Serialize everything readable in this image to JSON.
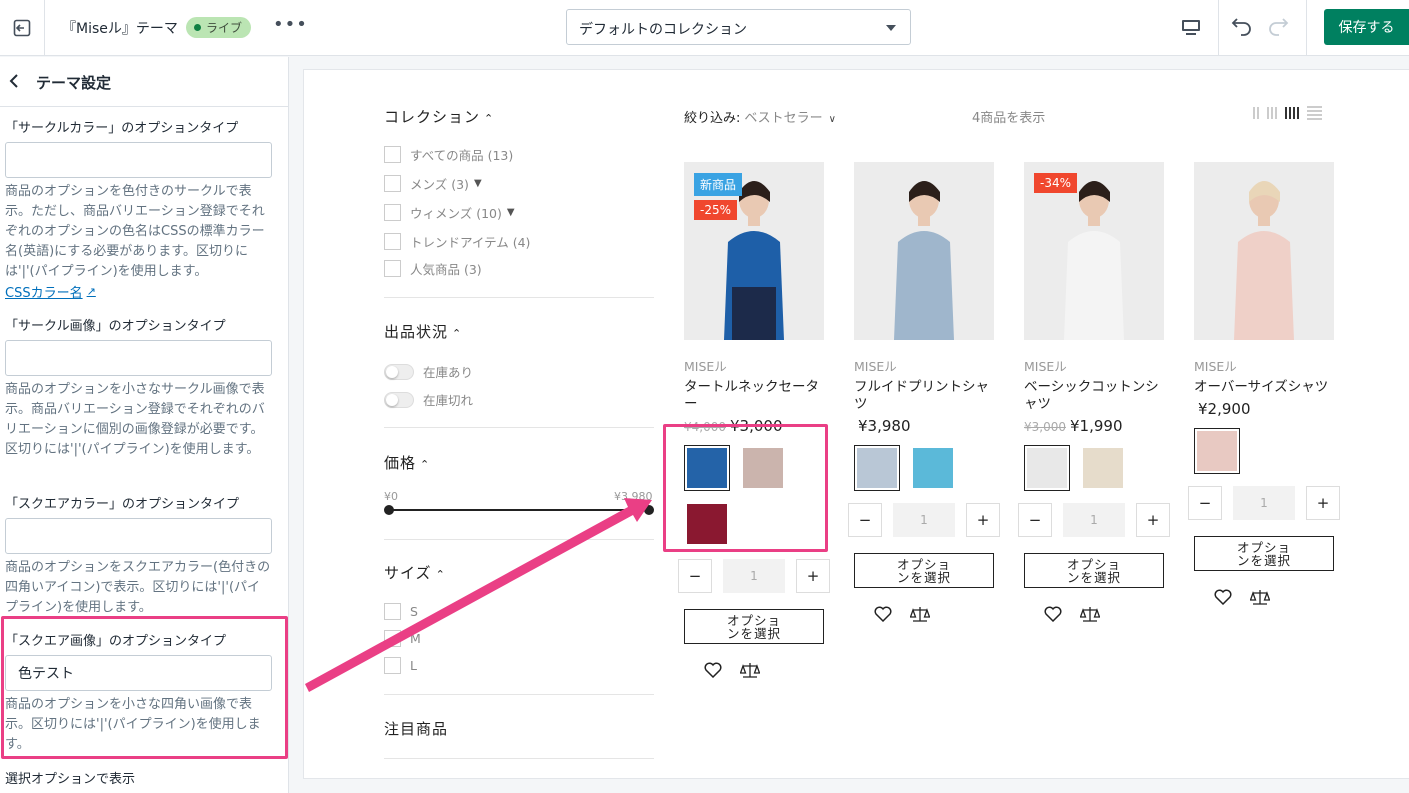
{
  "topbar": {
    "theme_name": "『Miseル』テーマ",
    "live_badge": "ライブ",
    "more": "•••",
    "collection_select": "デフォルトのコレクション",
    "save_label": "保存する"
  },
  "sidebar": {
    "title": "テーマ設定",
    "sections": [
      {
        "label": "「サークルカラー」のオプションタイプ",
        "value": "",
        "help": "商品のオプションを色付きのサークルで表示。ただし、商品バリエーション登録でそれぞれのオプションの色名はCSSの標準カラー名(英語)にする必要があります。区切りには'|'(パイプライン)を使用します。",
        "link": "CSSカラー名"
      },
      {
        "label": "「サークル画像」のオプションタイプ",
        "value": "",
        "help": "商品のオプションを小さなサークル画像で表示。商品バリエーション登録でそれぞれのバリエーションに個別の画像登録が必要です。区切りには'|'(パイプライン)を使用します。"
      },
      {
        "label": "「スクエアカラー」のオプションタイプ",
        "value": "",
        "help": "商品のオプションをスクエアカラー(色付きの四角いアイコン)で表示。区切りには'|'(パイプライン)を使用します。"
      },
      {
        "label": "「スクエア画像」のオプションタイプ",
        "value": "色テスト",
        "help": "商品のオプションを小さな四角い画像で表示。区切りには'|'(パイプライン)を使用します。"
      }
    ],
    "bottom_label": "選択オプションで表示"
  },
  "filters": {
    "collection_title": "コレクション",
    "collections": [
      {
        "label": "すべての商品 (13)",
        "sub": false
      },
      {
        "label": "メンズ (3)",
        "sub": true
      },
      {
        "label": "ウィメンズ (10)",
        "sub": true
      },
      {
        "label": "トレンドアイテム (4)",
        "sub": false
      },
      {
        "label": "人気商品 (3)",
        "sub": false
      }
    ],
    "stock_title": "出品状況",
    "stock": [
      "在庫あり",
      "在庫切れ"
    ],
    "price_title": "価格",
    "price_min": "¥0",
    "price_max": "¥3,980",
    "size_title": "サイズ",
    "sizes": [
      "S",
      "M",
      "L"
    ],
    "featured_title": "注目商品"
  },
  "toolbar": {
    "sort_prefix": "絞り込み:",
    "sort_value": "ベストセラー",
    "count": "4商品を表示"
  },
  "products": [
    {
      "badges": [
        {
          "text": "新商品",
          "type": "new"
        },
        {
          "text": "-25%",
          "type": "sale"
        }
      ],
      "vendor": "MISEル",
      "title": "タートルネックセーター",
      "old_price": "¥4,000",
      "price": "¥3,000",
      "image_color": "#1e5fa8",
      "swatches": [
        "#2463a8",
        "#cbb4ad",
        "#8a1830"
      ],
      "qty": "1",
      "option_label": "オプションを選択"
    },
    {
      "badges": [],
      "vendor": "MISEル",
      "title": "フルイドプリントシャツ",
      "old_price": "",
      "price": "¥3,980",
      "image_color": "#9fb6cc",
      "swatches": [
        "#b9c7d6",
        "#5bb9d9"
      ],
      "qty": "1",
      "option_label": "オプションを選択"
    },
    {
      "badges": [
        {
          "text": "-34%",
          "type": "sale"
        }
      ],
      "vendor": "MISEル",
      "title": "ベーシックコットンシャツ",
      "old_price": "¥3,000",
      "price": "¥1,990",
      "image_color": "#f4f4f4",
      "swatches": [
        "#e8e8e8",
        "#e6dccb"
      ],
      "qty": "1",
      "option_label": "オプションを選択"
    },
    {
      "badges": [],
      "vendor": "MISEル",
      "title": "オーバーサイズシャツ",
      "old_price": "",
      "price": "¥2,900",
      "image_color": "#efd0c8",
      "swatches": [
        "#e8c9c2"
      ],
      "qty": "1",
      "option_label": "オプションを選択"
    }
  ],
  "colors": {
    "accent_green": "#008060",
    "highlight_pink": "#ea3f85",
    "link_blue": "#006fbb"
  }
}
